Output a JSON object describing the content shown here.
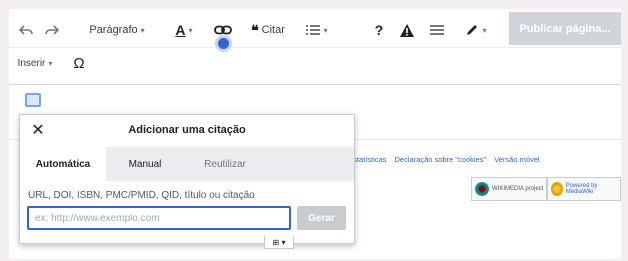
{
  "toolbar": {
    "undo_icon": "undo-icon",
    "redo_icon": "redo-icon",
    "paragraph_label": "Parágrafo",
    "text_style_icon": "text-style-icon",
    "link_icon": "link-icon",
    "cite_label": "Citar",
    "cite_icon": "quote-icon",
    "list_icon": "list-icon",
    "help_label": "?",
    "warning_icon": "warning-icon",
    "menu_icon": "hamburger-icon",
    "edit_icon": "pencil-icon",
    "publish_label": "Publicar página...",
    "insert_label": "Inserir",
    "special_char_label": "Ω"
  },
  "page": {
    "footer_links": [
      "estatísticas",
      "Declaração sobre \"cookies\"",
      "Versão móvel"
    ],
    "badges": [
      "WIKIMEDIA project",
      "Powered by MediaWiki"
    ]
  },
  "dialog": {
    "title": "Adicionar uma citação",
    "close_icon": "close-icon",
    "tabs": [
      {
        "label": "Automática",
        "state": "active"
      },
      {
        "label": "Manual",
        "state": "normal"
      },
      {
        "label": "Reutilizar",
        "state": "muted"
      }
    ],
    "field_label": "URL, DOI, ISBN, PMC/PMID, QID, título ou citação",
    "input_placeholder": "ex: http://www.exemplo.com",
    "input_value": "",
    "generate_label": "Gerar",
    "tail_label": "⊞ ▾"
  },
  "colors": {
    "accent": "#3366cc",
    "publish_disabled": "#cfd3da",
    "tabs_bg": "#eaecf0"
  }
}
